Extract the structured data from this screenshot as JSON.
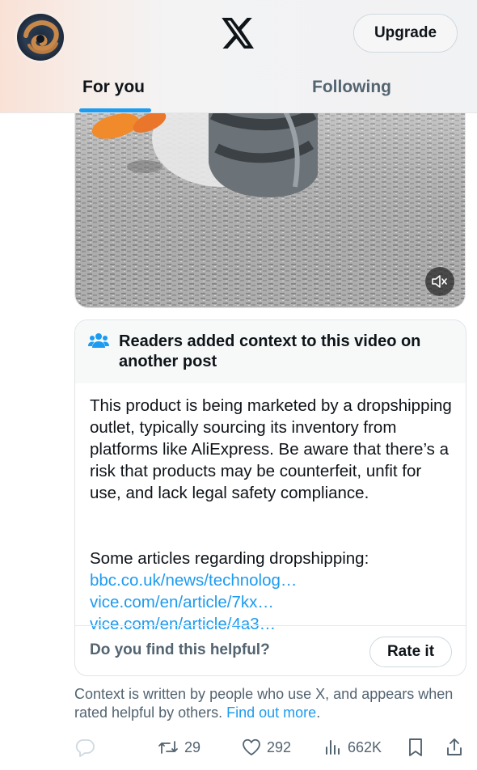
{
  "header": {
    "logo_icon": "x-logo-icon",
    "upgrade_label": "Upgrade",
    "tabs": [
      {
        "label": "For you",
        "active": true
      },
      {
        "label": "Following",
        "active": false
      }
    ],
    "accent_color": "#1d9bf0"
  },
  "video": {
    "mute_icon": "speaker-muted-icon"
  },
  "note": {
    "icon": "people-icon",
    "title": "Readers added context to this video on another post",
    "body": "This product is being marketed by a dropshipping outlet, typically sourcing its inventory from platforms like AliExpress. Be aware that there’s a risk that products may be counterfeit, unfit for use, and lack legal safety compliance.",
    "articles_intro": "Some articles regarding dropshipping:",
    "links": [
      "bbc.co.uk/news/technolog…",
      "vice.com/en/article/7kx…",
      "vice.com/en/article/4a3…"
    ],
    "helpful_question": "Do you find this helpful?",
    "rate_label": "Rate it"
  },
  "context_footer": {
    "text": "Context is written by people who use X, and appears when rated helpful by others.",
    "link": "Find out more",
    "suffix": "."
  },
  "actions": {
    "reply_count": "",
    "retweet_count": "29",
    "like_count": "292",
    "views_count": "662K"
  }
}
